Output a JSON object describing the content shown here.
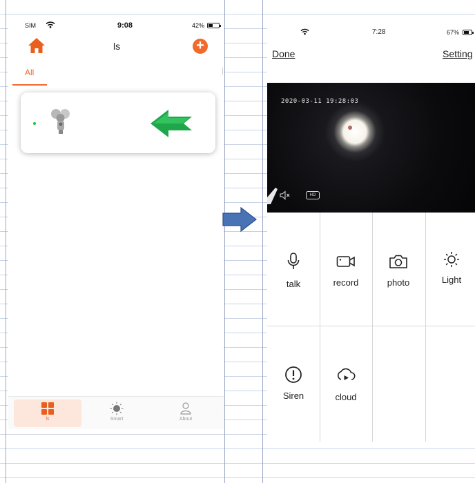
{
  "left_screen": {
    "status_bar": {
      "carrier": "SIM",
      "time": "9:08",
      "battery": "42%",
      "battery_level": 0.42
    },
    "header": {
      "title": "ls",
      "home_icon": "home-icon",
      "add_icon": "plus-icon"
    },
    "tabs": [
      {
        "label": "All",
        "active": true
      }
    ],
    "device_card": {
      "online_color": "#2bbf3e",
      "camera_icon": "camera-thumbnail",
      "pointer_icon": "green-arrow-icon"
    },
    "bottom_nav": [
      {
        "label": "ls",
        "icon": "grid-icon",
        "active": true
      },
      {
        "label": "Smart",
        "icon": "sun-icon",
        "active": false
      },
      {
        "label": "About",
        "icon": "person-icon",
        "active": false
      }
    ],
    "accent_color": "#f26a2b"
  },
  "transition_arrow": {
    "icon": "blue-arrow-icon",
    "color": "#4a73b5"
  },
  "right_screen": {
    "status_bar": {
      "time": "7:28",
      "battery": "67%",
      "battery_level": 0.67
    },
    "header": {
      "left_link": "Done",
      "right_link": "Setting"
    },
    "video": {
      "timestamp": "2020-03-11 19:28:03",
      "quality_badge": "HD",
      "mute_icon": "speaker-mute-icon"
    },
    "actions": [
      {
        "label": "talk",
        "icon": "microphone-icon"
      },
      {
        "label": "record",
        "icon": "video-camera-icon"
      },
      {
        "label": "photo",
        "icon": "camera-icon"
      },
      {
        "label": "Light",
        "icon": "sun-icon"
      },
      {
        "label": "Siren",
        "icon": "alert-icon"
      },
      {
        "label": "cloud",
        "icon": "cloud-play-icon"
      }
    ]
  }
}
